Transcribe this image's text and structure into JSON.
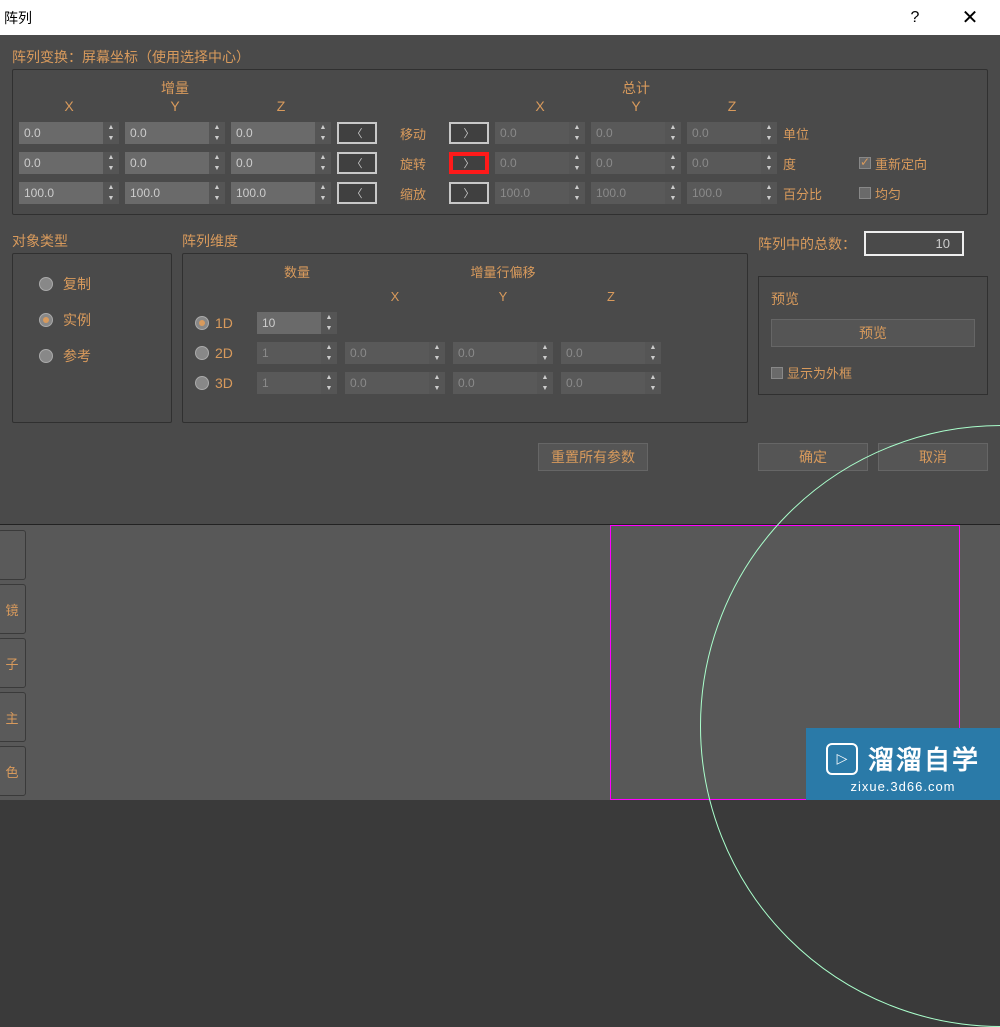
{
  "titlebar": {
    "title": "阵列",
    "help": "?",
    "close": "✕"
  },
  "arrayTransform": {
    "title": "阵列变换：屏幕坐标（使用选择中心）",
    "incremental": "增量",
    "totals": "总计",
    "cols": {
      "x": "X",
      "y": "Y",
      "z": "Z"
    },
    "rows": {
      "move": {
        "label": "移动",
        "unit": "单位",
        "inc": {
          "x": "0.0",
          "y": "0.0",
          "z": "0.0"
        },
        "tot": {
          "x": "0.0",
          "y": "0.0",
          "z": "0.0"
        }
      },
      "rotate": {
        "label": "旋转",
        "unit": "度",
        "inc": {
          "x": "0.0",
          "y": "0.0",
          "z": "0.0"
        },
        "tot": {
          "x": "0.0",
          "y": "0.0",
          "z": "0.0"
        }
      },
      "scale": {
        "label": "缩放",
        "unit": "百分比",
        "inc": {
          "x": "100.0",
          "y": "100.0",
          "z": "100.0"
        },
        "tot": {
          "x": "100.0",
          "y": "100.0",
          "z": "100.0"
        }
      }
    },
    "reorient": "重新定向",
    "uniform": "均匀"
  },
  "objectType": {
    "title": "对象类型",
    "copy": "复制",
    "instance": "实例",
    "reference": "参考"
  },
  "arrayDim": {
    "title": "阵列维度",
    "count": "数量",
    "offset": "增量行偏移",
    "cols": {
      "x": "X",
      "y": "Y",
      "z": "Z"
    },
    "d1": {
      "label": "1D",
      "count": "10"
    },
    "d2": {
      "label": "2D",
      "count": "1",
      "x": "0.0",
      "y": "0.0",
      "z": "0.0"
    },
    "d3": {
      "label": "3D",
      "count": "1",
      "x": "0.0",
      "y": "0.0",
      "z": "0.0"
    }
  },
  "totalCount": {
    "label": "阵列中的总数：",
    "value": "10"
  },
  "preview": {
    "title": "预览",
    "button": "预览",
    "wireframe": "显示为外框"
  },
  "buttons": {
    "reset": "重置所有参数",
    "ok": "确定",
    "cancel": "取消"
  },
  "sideButtons": [
    "",
    "镜",
    "子",
    "主",
    "色"
  ],
  "watermark": {
    "name": "溜溜自学",
    "url": "zixue.3d66.com"
  }
}
